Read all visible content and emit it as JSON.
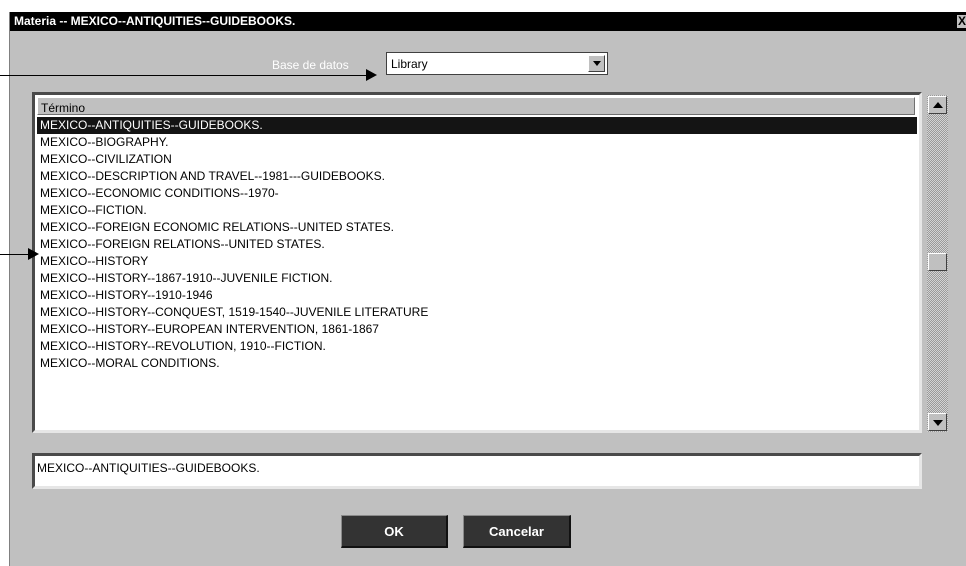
{
  "window": {
    "title": "Materia -- MEXICO--ANTIQUITIES--GUIDEBOOKS.",
    "close_glyph": "X"
  },
  "database": {
    "label": "Base de datos",
    "selected": "Library"
  },
  "list": {
    "header": "Término",
    "items": [
      "MEXICO--ANTIQUITIES--GUIDEBOOKS.",
      "MEXICO--BIOGRAPHY.",
      "MEXICO--CIVILIZATION",
      "MEXICO--DESCRIPTION AND TRAVEL--1981---GUIDEBOOKS.",
      "MEXICO--ECONOMIC CONDITIONS--1970-",
      "MEXICO--FICTION.",
      "MEXICO--FOREIGN ECONOMIC RELATIONS--UNITED STATES.",
      "MEXICO--FOREIGN RELATIONS--UNITED STATES.",
      "MEXICO--HISTORY",
      "MEXICO--HISTORY--1867-1910--JUVENILE FICTION.",
      "MEXICO--HISTORY--1910-1946",
      "MEXICO--HISTORY--CONQUEST, 1519-1540--JUVENILE LITERATURE",
      "MEXICO--HISTORY--EUROPEAN INTERVENTION, 1861-1867",
      "MEXICO--HISTORY--REVOLUTION, 1910--FICTION.",
      "MEXICO--MORAL CONDITIONS."
    ],
    "selected_index": 0
  },
  "selected_term": "MEXICO--ANTIQUITIES--GUIDEBOOKS.",
  "buttons": {
    "ok": "OK",
    "cancel": "Cancelar"
  },
  "colors": {
    "dialog_bg": "#c0c0c0",
    "titlebar": "#000000",
    "selection": "#141414",
    "button_bg": "#333333"
  },
  "icons": {
    "dropdown": "triangle-down",
    "scroll_up": "triangle-up",
    "scroll_down": "triangle-down"
  }
}
